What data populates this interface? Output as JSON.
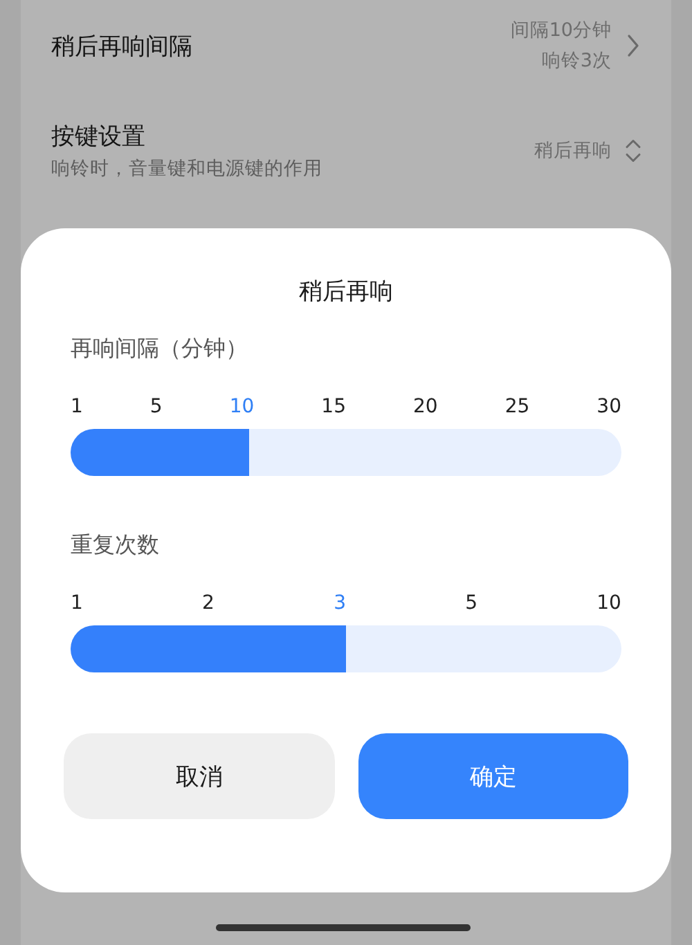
{
  "settings": [
    {
      "title": "稍后再响间隔",
      "value_lines": [
        "间隔10分钟",
        "响铃3次"
      ],
      "kind": "link"
    },
    {
      "title": "按键设置",
      "subtitle": "响铃时，音量键和电源键的作用",
      "value_lines": [
        "稍后再响"
      ],
      "kind": "picker"
    }
  ],
  "dialog": {
    "title": "稍后再响",
    "sliders": [
      {
        "label": "再响间隔（分钟）",
        "ticks": [
          {
            "label": "1",
            "selected": false
          },
          {
            "label": "5",
            "selected": false
          },
          {
            "label": "10",
            "selected": true
          },
          {
            "label": "15",
            "selected": false
          },
          {
            "label": "20",
            "selected": false
          },
          {
            "label": "25",
            "selected": false
          },
          {
            "label": "30",
            "selected": false
          }
        ],
        "level": 0.324
      },
      {
        "label": "重复次数",
        "ticks": [
          {
            "label": "1",
            "selected": false
          },
          {
            "label": "2",
            "selected": false
          },
          {
            "label": "3",
            "selected": true
          },
          {
            "label": "5",
            "selected": false
          },
          {
            "label": "10",
            "selected": false
          }
        ],
        "level": 0.5
      }
    ],
    "buttons": [
      {
        "label": "取消",
        "kind": "secondary"
      },
      {
        "label": "确定",
        "kind": "primary"
      }
    ]
  }
}
